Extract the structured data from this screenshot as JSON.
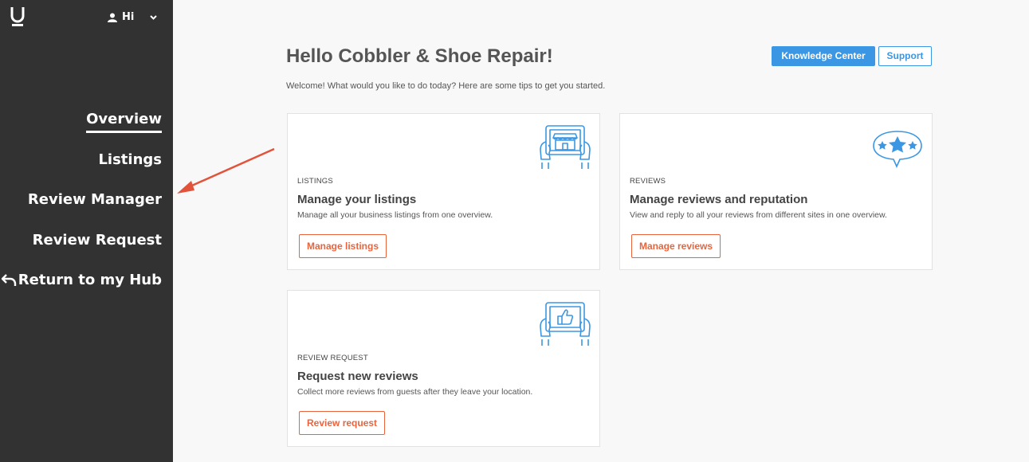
{
  "sidebar": {
    "logo": "U",
    "user_label": "Hi",
    "items": [
      {
        "label": "Overview",
        "active": true
      },
      {
        "label": "Listings"
      },
      {
        "label": "Review Manager"
      },
      {
        "label": "Review Request"
      },
      {
        "label": "Return to my Hub"
      }
    ]
  },
  "header": {
    "title": "Hello Cobbler & Shoe Repair!",
    "subtitle": "Welcome! What would you like to do today? Here are some tips to get you started.",
    "knowledge_center": "Knowledge Center",
    "support": "Support"
  },
  "cards": [
    {
      "kicker": "LISTINGS",
      "title": "Manage your listings",
      "description": "Manage all your business listings from one overview.",
      "button": "Manage listings",
      "icon": "tablet-storefront-icon"
    },
    {
      "kicker": "REVIEWS",
      "title": "Manage reviews and reputation",
      "description": "View and reply to all your reviews from different sites in one overview.",
      "button": "Manage reviews",
      "icon": "stars-speech-bubble-icon"
    },
    {
      "kicker": "REVIEW REQUEST",
      "title": "Request new reviews",
      "description": "Collect more reviews from guests after they leave your location.",
      "button": "Review request",
      "icon": "tablet-thumbs-up-icon"
    }
  ],
  "colors": {
    "sidebar": "#323232",
    "primary": "#3b97e3",
    "accent": "#e9643d",
    "annotation": "#e2533b"
  }
}
